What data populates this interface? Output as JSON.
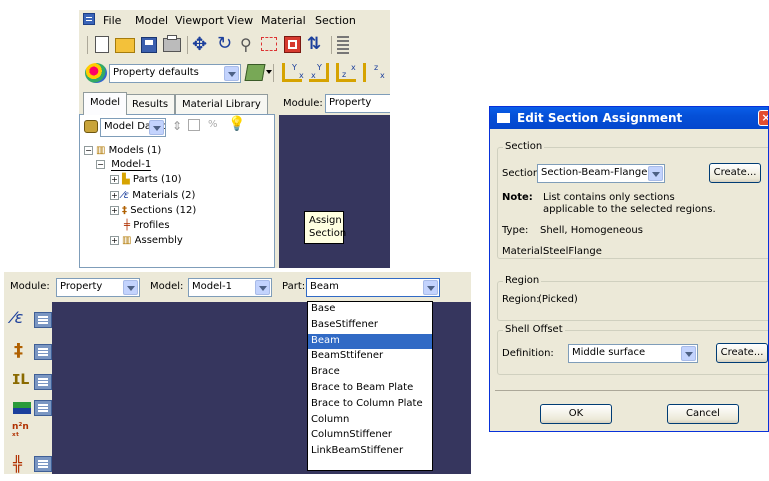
{
  "top_window": {
    "menu": [
      "File",
      "Model",
      "Viewport",
      "View",
      "Material",
      "Section"
    ],
    "property_defaults_label": "Property defaults",
    "tabs": [
      "Model",
      "Results",
      "Material Library"
    ],
    "module_label": "Module:",
    "module_value": "Property",
    "tree_filter_value": "Model Datab",
    "tree": {
      "models": "Models (1)",
      "model1": "Model-1",
      "parts": "Parts (10)",
      "materials": "Materials (2)",
      "sections": "Sections (12)",
      "profiles": "Profiles",
      "assembly": "Assembly"
    },
    "tooltip_line1": "Assign",
    "tooltip_line2": "Section"
  },
  "part_window": {
    "module_label": "Module:",
    "module_value": "Property",
    "model_label": "Model:",
    "model_value": "Model-1",
    "part_label": "Part:",
    "part_value": "Beam",
    "part_options": [
      "Base",
      "BaseStiffener",
      "Beam",
      "BeamSttifener",
      "Brace",
      "Brace to Beam Plate",
      "Brace to Column Plate",
      "Column",
      "ColumnStiffener",
      "LinkBeamStiffener"
    ],
    "selected_index": 2
  },
  "dialog": {
    "title": "Edit Section Assignment",
    "close_glyph": "×",
    "section_group": "Section",
    "section_label": "Section:",
    "section_value": "Section-Beam-Flange",
    "create_label": "Create...",
    "note_label": "Note:",
    "note_line1": "List contains only sections",
    "note_line2": "applicable to the selected regions.",
    "type_label": "Type:",
    "type_value": "Shell, Homogeneous",
    "material_label": "Material:",
    "material_value": "SteelFlange",
    "region_group": "Region",
    "region_label": "Region:",
    "region_value": "(Picked)",
    "offset_group": "Shell Offset",
    "definition_label": "Definition:",
    "definition_value": "Middle surface",
    "create2_label": "Create...",
    "ok_label": "OK",
    "cancel_label": "Cancel"
  },
  "colors": {
    "viewport": "#36365e",
    "chrome": "#ece9d8",
    "title_bar": "#0550d8",
    "selection": "#316ac5"
  }
}
